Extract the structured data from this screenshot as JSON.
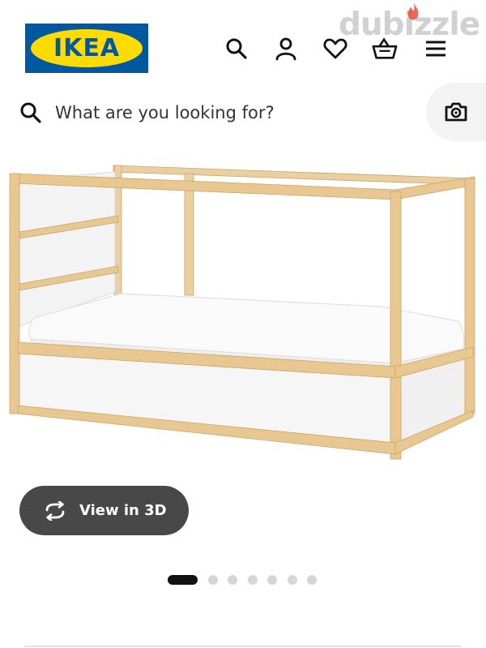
{
  "header": {
    "logo_text": "IKEA",
    "watermark": "dubizzle",
    "icons": [
      "search-icon",
      "account-icon",
      "heart-icon",
      "basket-icon",
      "menu-icon"
    ]
  },
  "search": {
    "placeholder": "What are you looking for?",
    "icon": "search-icon",
    "camera_icon": "camera-icon"
  },
  "product": {
    "image": "bed-product-image"
  },
  "view3d": {
    "label": "View in 3D",
    "icon": "rotate-icon"
  },
  "carousel": {
    "total_slides": 7,
    "active_slide": 1
  },
  "colors": {
    "ikea_blue": "#0058a3",
    "ikea_yellow": "#ffdb00",
    "button_bg": "#484848",
    "dot_inactive": "#d6d6d6",
    "dot_active": "#111111",
    "pine": "#e8c890"
  }
}
